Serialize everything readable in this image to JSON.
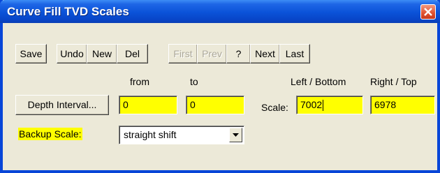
{
  "window": {
    "title": "Curve Fill TVD Scales"
  },
  "toolbar": {
    "save": "Save",
    "undo": "Undo",
    "new": "New",
    "del": "Del",
    "first": "First",
    "prev": "Prev",
    "help": "?",
    "next": "Next",
    "last": "Last"
  },
  "depth": {
    "button": "Depth Interval...",
    "from_label": "from",
    "to_label": "to",
    "from_value": "0",
    "to_value": "0"
  },
  "scale": {
    "label": "Scale:",
    "left_bottom_label": "Left / Bottom",
    "right_top_label": "Right / Top",
    "left_value": "7002",
    "right_value": "6978"
  },
  "backup": {
    "label": "Backup Scale:",
    "selected": "straight shift"
  },
  "colors": {
    "field_highlight": "#ffff00",
    "titlebar": "#0a52d8",
    "dialog_bg": "#ece9d8"
  }
}
